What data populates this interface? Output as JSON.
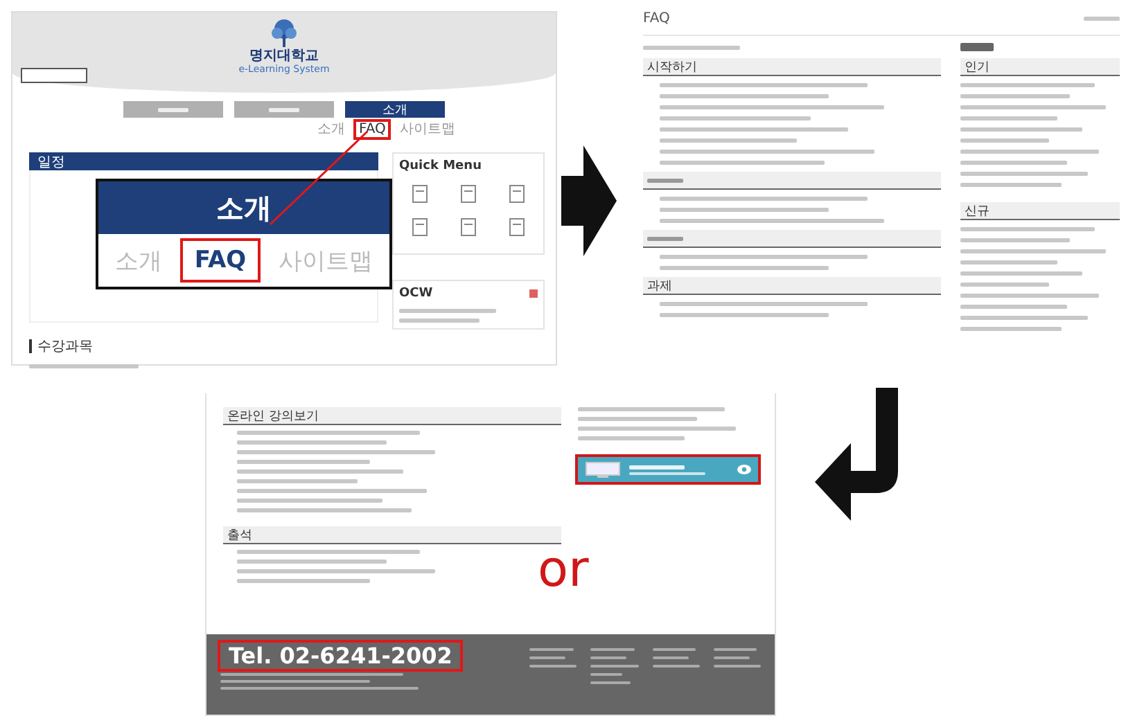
{
  "main_screen": {
    "university": "명지대학교",
    "system": "e-Learning System",
    "nav_tabs": [
      {
        "selected": false
      },
      {
        "selected": false
      },
      {
        "label": "소개",
        "selected": true
      }
    ],
    "sub_menu": [
      {
        "label": "소개",
        "selected": false
      },
      {
        "label": "FAQ",
        "selected": true
      },
      {
        "label": "사이트맵",
        "selected": false
      }
    ],
    "schedule_title": "일정",
    "quick_menu_title": "Quick Menu",
    "ocw_title": "OCW",
    "courses_title": "수강과목",
    "callout": {
      "header": "소개",
      "items": [
        {
          "label": "소개",
          "selected": false
        },
        {
          "label": "FAQ",
          "selected": true
        },
        {
          "label": "사이트맵",
          "selected": false
        }
      ]
    }
  },
  "faq_screen": {
    "title": "FAQ",
    "sections": [
      {
        "kind": "titled",
        "title": "시작하기"
      },
      {
        "kind": "blurred"
      },
      {
        "kind": "blurred"
      },
      {
        "kind": "titled",
        "title": "과제"
      }
    ],
    "side_sections": [
      {
        "title": "인기"
      },
      {
        "title": "신규"
      }
    ]
  },
  "bottom_screen": {
    "sections": [
      {
        "title": "온라인 강의보기"
      },
      {
        "title": "출석"
      }
    ],
    "phone": "Tel. 02-6241-2002"
  },
  "connector": "or"
}
